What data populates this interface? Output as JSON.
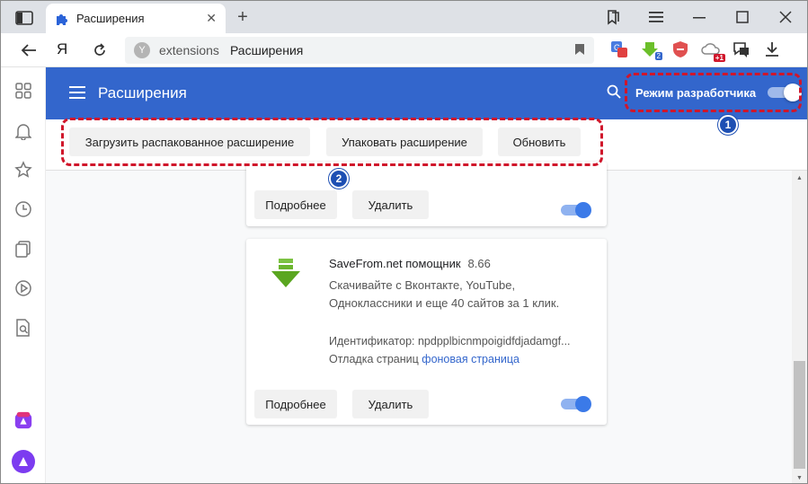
{
  "window": {
    "tab_title": "Расширения",
    "colors": {
      "accent": "#3366cc",
      "annotation": "#d0162b"
    }
  },
  "toolbar": {
    "logo": "Я",
    "address_host": "extensions",
    "address_title": "Расширения",
    "badge_plus_one": "+1",
    "badge_two": "2"
  },
  "header": {
    "title": "Расширения",
    "dev_mode_label": "Режим разработчика",
    "dev_mode_on": true
  },
  "dev_bar": {
    "load_unpacked": "Загрузить распакованное расширение",
    "pack": "Упаковать расширение",
    "update": "Обновить"
  },
  "cards": [
    {
      "details_label": "Подробнее",
      "remove_label": "Удалить",
      "enabled": true
    },
    {
      "name": "SaveFrom.net помощник",
      "version": "8.66",
      "description": "Скачивайте с Вконтакте, YouTube, Одноклассники и еще 40 сайтов за 1 клик.",
      "id_text": "Идентификатор: npdpplbicnmpoigidfdjadamgf...",
      "debug_label": "Отладка страниц",
      "debug_link": "фоновая страница",
      "details_label": "Подробнее",
      "remove_label": "Удалить",
      "enabled": true
    }
  ],
  "annotations": {
    "one": "1",
    "two": "2"
  }
}
